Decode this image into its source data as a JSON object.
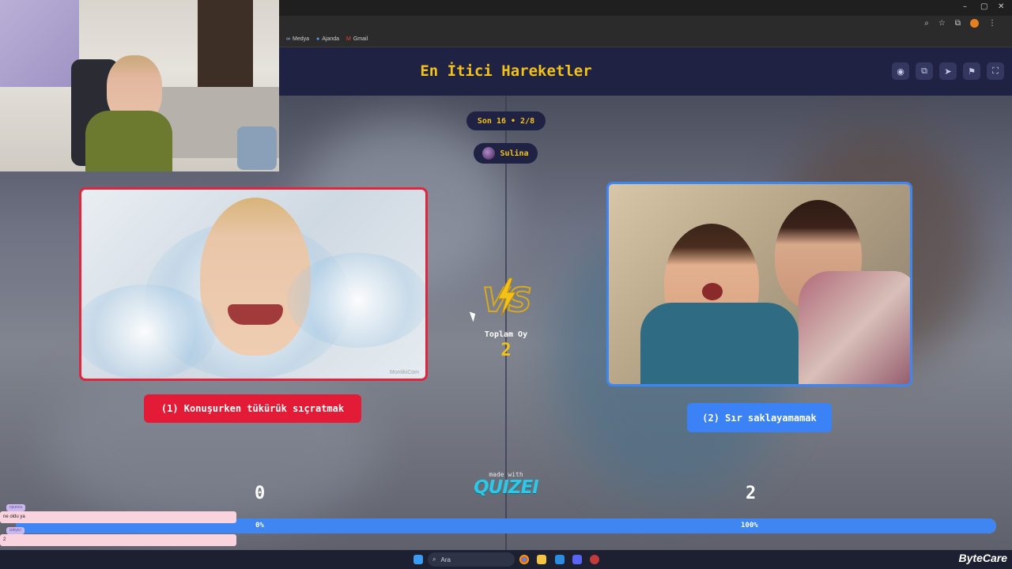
{
  "browser": {
    "bookmarks": [
      {
        "icon": "media-icon",
        "label": "Medya"
      },
      {
        "icon": "calendar-icon",
        "label": "Ajanda"
      },
      {
        "icon": "gmail-icon",
        "label": "Gmail"
      }
    ],
    "window_controls": {
      "minimize": "–",
      "maximize": "▢",
      "close": "✕"
    }
  },
  "app": {
    "title": "En İtici Hareketler",
    "header_icons": [
      "eye-icon",
      "share-icon",
      "send-icon",
      "flag-icon",
      "fullscreen-icon"
    ],
    "round_label": "Son 16 • 2/8",
    "player_name": "Sulina"
  },
  "match": {
    "left": {
      "label": "(1) Konuşurken tükürük sıçratmak",
      "score": "0",
      "percent": "0%",
      "percent_value": 0,
      "watermark": "MontikiCom",
      "border_color": "#e0263e"
    },
    "right": {
      "label": "(2) Sır saklayamamak",
      "score": "2",
      "percent": "100%",
      "percent_value": 100,
      "border_color": "#3f86f2"
    },
    "vs_icon": "vs-lightning-icon",
    "total_label": "Toplam Oy",
    "total_value": "2"
  },
  "footer": {
    "made_with": "made with",
    "brand": "QUIZEI"
  },
  "chat": {
    "messages": [
      {
        "user": "oyuncu",
        "text": "ne oldu ya"
      },
      {
        "user": "izleyici",
        "text": "2"
      },
      {
        "user": "izleyici2",
        "text": ""
      }
    ]
  },
  "taskbar": {
    "search_placeholder": "Ara",
    "brand": "ByteCare"
  },
  "colors": {
    "accent_yellow": "#f2c21b",
    "red": "#e31b37",
    "blue": "#3b82f6",
    "header_bg": "#1f2242"
  }
}
